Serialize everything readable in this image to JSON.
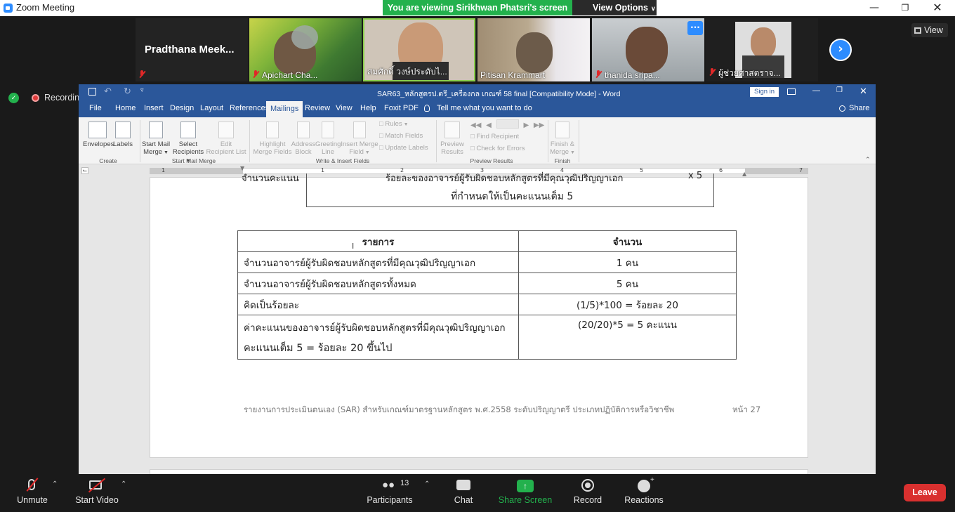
{
  "zoom": {
    "window_title": "Zoom Meeting",
    "viewing_banner": "You are viewing Sirikhwan Phatsri's screen",
    "view_options_label": "View Options",
    "view_label": "View",
    "recording_label": "Recording",
    "participants": [
      {
        "name": "Pradthana  Meek..."
      },
      {
        "name": "Apichart Cha..."
      },
      {
        "name": "สมศักดิ์ วงษ์ประดับไ..."
      },
      {
        "name": "Pitisan Krammart"
      },
      {
        "name": "thanida sripa..."
      },
      {
        "name": "ผู้ช่วยศาสตราจ..."
      }
    ],
    "more_label": "···",
    "toolbar": {
      "unmute": "Unmute",
      "start_video": "Start Video",
      "participants": "Participants",
      "participants_count": "13",
      "chat": "Chat",
      "share_screen": "Share Screen",
      "record": "Record",
      "reactions": "Reactions",
      "leave": "Leave"
    },
    "colors": {
      "share_green": "#23b14d",
      "leave_red": "#d9302f",
      "word_blue": "#2b579a"
    }
  },
  "word": {
    "doc_title": "SAR63_หลักสูตรป.ตรี_เครื่องกล เกณฑ์ 58 final [Compatibility Mode]  -  Word",
    "sign_in": "Sign in",
    "share": "Share",
    "tabs": [
      "File",
      "Home",
      "Insert",
      "Design",
      "Layout",
      "References",
      "Mailings",
      "Review",
      "View",
      "Help",
      "Foxit PDF"
    ],
    "active_tab": "Mailings",
    "tell_me": "Tell me what you want to do",
    "ribbon": {
      "envelopes": "Envelopes",
      "labels": "Labels",
      "group_create": "Create",
      "start_mail_merge_1": "Start Mail",
      "start_mail_merge_2": "Merge",
      "select_recipients_1": "Select",
      "select_recipients_2": "Recipients",
      "edit_recipient_list_1": "Edit",
      "edit_recipient_list_2": "Recipient List",
      "group_start_mail_merge": "Start Mail Merge",
      "highlight_merge_fields_1": "Highlight",
      "highlight_merge_fields_2": "Merge Fields",
      "address_block_1": "Address",
      "address_block_2": "Block",
      "greeting_line_1": "Greeting",
      "greeting_line_2": "Line",
      "insert_merge_field_1": "Insert Merge",
      "insert_merge_field_2": "Field",
      "rules": "Rules",
      "match_fields": "Match Fields",
      "update_labels": "Update Labels",
      "group_write_insert": "Write & Insert Fields",
      "preview_results_1": "Preview",
      "preview_results_2": "Results",
      "find_recipient": "Find Recipient",
      "check_for_errors": "Check for Errors",
      "group_preview_results": "Preview Results",
      "finish_merge_1": "Finish &",
      "finish_merge_2": "Merge",
      "group_finish": "Finish"
    },
    "ruler_numbers": [
      "1",
      "1",
      "2",
      "3",
      "4",
      "5",
      "6",
      "7"
    ],
    "document": {
      "top_cut_left": "จำนวนคะแนน",
      "top_cut_mid": "ร้อยละของอาจารย์ผู้รับผิดชอบหลักสูตรที่มีคุณวุฒิปริญญาเอก",
      "top_cut_right": "x 5",
      "top_line2": "ที่กำหนดให้เป็นคะแนนเต็ม 5",
      "table": {
        "headers": [
          "รายการ",
          "จำนวน"
        ],
        "rows": [
          [
            "จำนวนอาจารย์ผู้รับผิดชอบหลักสูตรที่มีคุณวุฒิปริญญาเอก",
            "1 คน"
          ],
          [
            "จำนวนอาจารย์ผู้รับผิดชอบหลักสูตรทั้งหมด",
            "5 คน"
          ],
          [
            "คิดเป็นร้อยละ",
            "(1/5)*100 = ร้อยละ 20"
          ],
          [
            "ค่าคะแนนของอาจารย์ผู้รับผิดชอบหลักสูตรที่มีคุณวุฒิปริญญาเอก",
            "(20/20)*5 = 5 คะแนน"
          ]
        ],
        "last_row_line2": "คะแนนเต็ม 5 = ร้อยละ 20 ขึ้นไป"
      },
      "footer": "รายงานการประเมินตนเอง (SAR) สำหรับเกณฑ์มาตรฐานหลักสูตร พ.ศ.2558 ระดับปริญญาตรี ประเภทปฏิบัติการหรือวิชาชีพ",
      "page_no": "หน้า 27"
    }
  }
}
